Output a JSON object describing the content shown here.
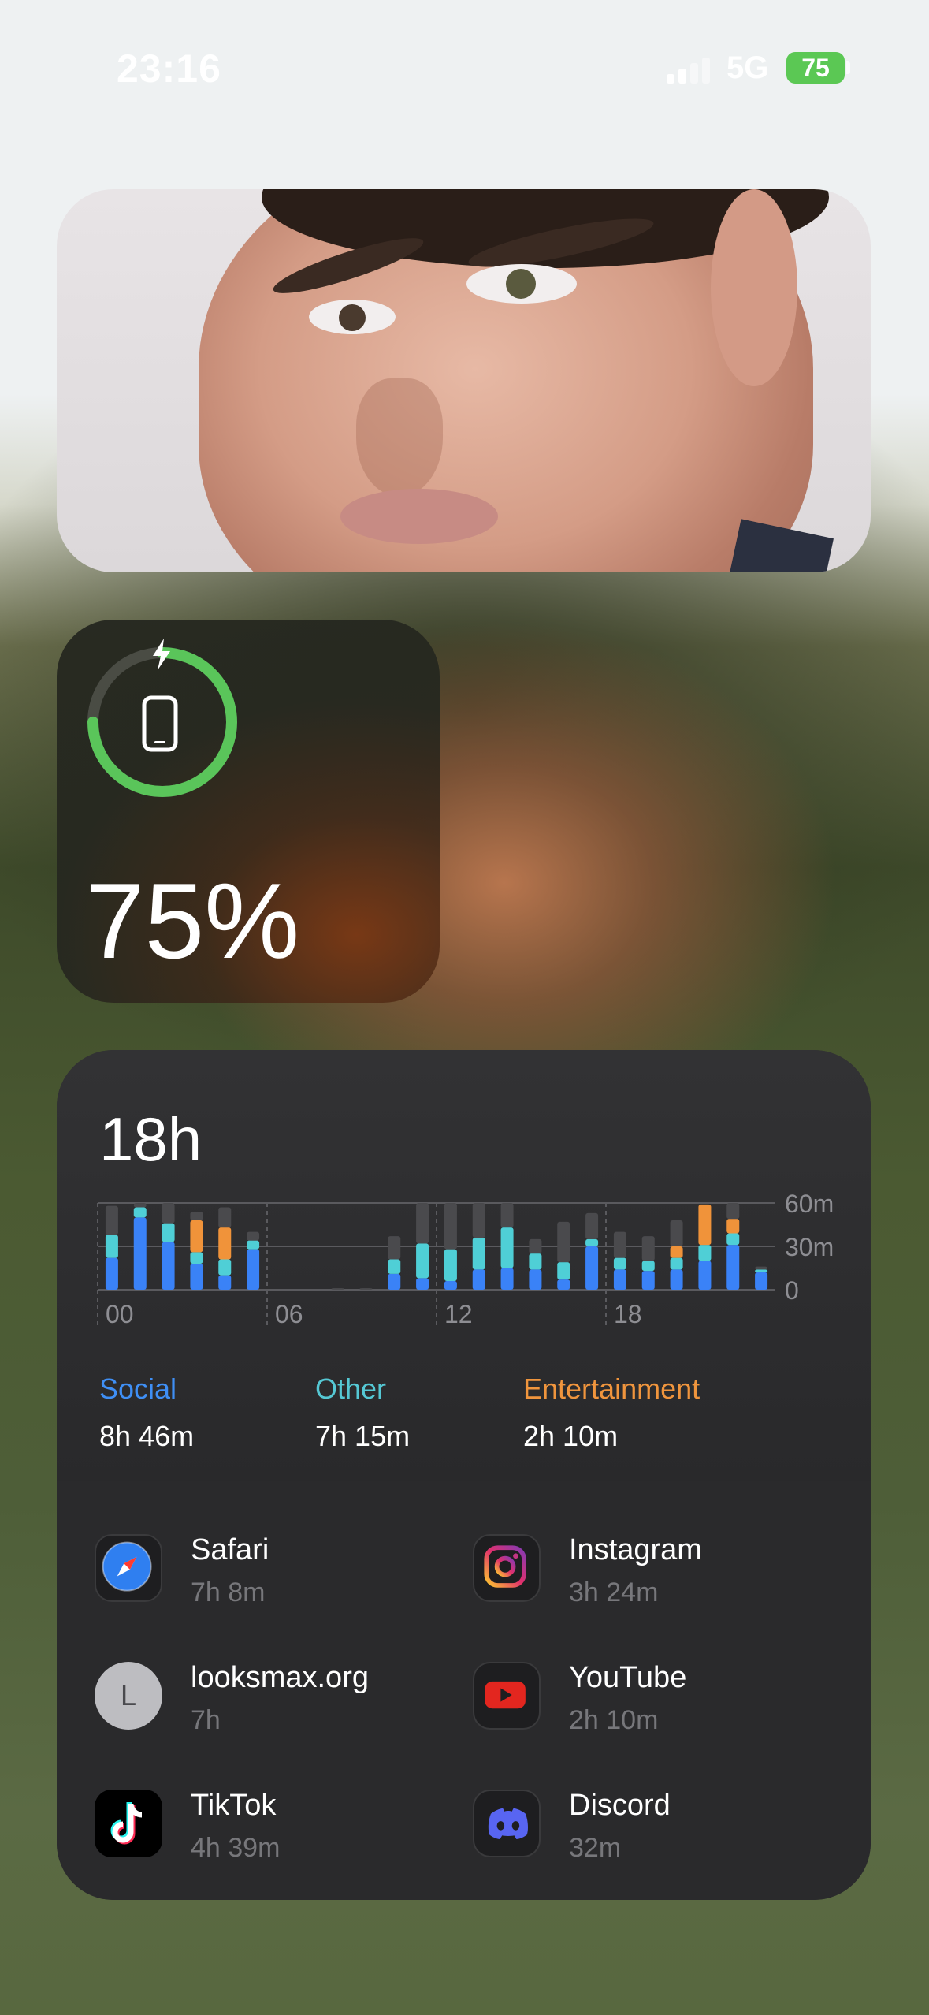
{
  "status_bar": {
    "time": "23:16",
    "network": "5G",
    "battery": "75"
  },
  "battery_widget": {
    "percent_label": "75%",
    "level": 0.75,
    "charging": true,
    "ring_color": "#5ac55a"
  },
  "screen_time": {
    "total": "18h",
    "chart_data": {
      "type": "bar",
      "x_ticks": [
        "00",
        "06",
        "12",
        "18"
      ],
      "y_ticks": [
        "60m",
        "30m",
        "0"
      ],
      "ylim": [
        0,
        60
      ],
      "hours": [
        0,
        1,
        2,
        3,
        4,
        5,
        6,
        7,
        8,
        9,
        10,
        11,
        12,
        13,
        14,
        15,
        16,
        17,
        18,
        19,
        20,
        21,
        22,
        23
      ],
      "series": [
        {
          "name": "Social",
          "color": "#3a82f7",
          "values": [
            22,
            50,
            33,
            18,
            10,
            28,
            0,
            0,
            0,
            0,
            11,
            8,
            6,
            14,
            15,
            14,
            7,
            30,
            14,
            13,
            14,
            20,
            31,
            12
          ]
        },
        {
          "name": "Other",
          "color": "#4fcfd6",
          "values": [
            16,
            7,
            13,
            8,
            11,
            6,
            0,
            0,
            0,
            0,
            10,
            24,
            22,
            22,
            28,
            11,
            12,
            5,
            8,
            7,
            8,
            11,
            8,
            2
          ]
        },
        {
          "name": "Entertainment",
          "color": "#f0933a",
          "values": [
            0,
            0,
            0,
            22,
            22,
            0,
            0,
            0,
            0,
            0,
            0,
            0,
            0,
            0,
            0,
            0,
            0,
            0,
            0,
            0,
            8,
            28,
            10,
            0
          ]
        },
        {
          "name": "",
          "color": "#4a4a4d",
          "values": [
            20,
            3,
            14,
            6,
            14,
            6,
            0,
            0,
            1,
            1,
            16,
            28,
            32,
            24,
            17,
            10,
            28,
            18,
            18,
            17,
            18,
            0,
            11,
            2
          ]
        }
      ]
    },
    "categories": [
      {
        "label": "Social",
        "value": "8h 46m",
        "color": "#3f8ff5"
      },
      {
        "label": "Other",
        "value": "7h 15m",
        "color": "#55c8d4"
      },
      {
        "label": "Entertainment",
        "value": "2h 10m",
        "color": "#f0953d"
      }
    ],
    "apps": [
      {
        "name": "Safari",
        "time": "7h 8m",
        "icon": "safari-icon"
      },
      {
        "name": "Instagram",
        "time": "3h 24m",
        "icon": "instagram-icon"
      },
      {
        "name": "looksmax.org",
        "time": "7h",
        "icon": "letter-l-icon",
        "letter": "L"
      },
      {
        "name": "YouTube",
        "time": "2h 10m",
        "icon": "youtube-icon"
      },
      {
        "name": "TikTok",
        "time": "4h 39m",
        "icon": "tiktok-icon"
      },
      {
        "name": "Discord",
        "time": "32m",
        "icon": "discord-icon"
      }
    ]
  }
}
